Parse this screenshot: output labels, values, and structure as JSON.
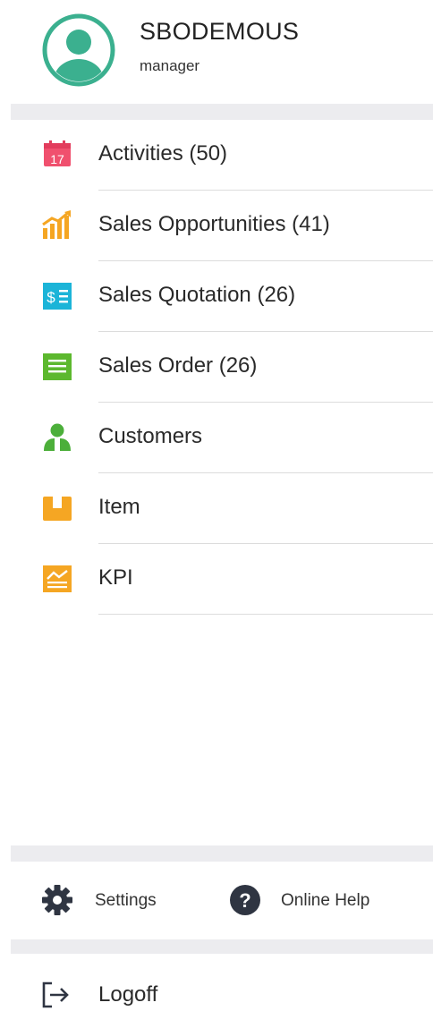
{
  "profile": {
    "name": "SBODEMOUS",
    "role": "manager",
    "avatar_icon": "user-avatar-icon",
    "avatar_color": "#3bb08f"
  },
  "menu": [
    {
      "label": "Activities (50)",
      "icon": "calendar-icon",
      "color": "#f0506e"
    },
    {
      "label": "Sales Opportunities (41)",
      "icon": "bar-chart-icon",
      "color": "#f5a623"
    },
    {
      "label": "Sales Quotation (26)",
      "icon": "quotation-icon",
      "color": "#1bb4d8"
    },
    {
      "label": "Sales Order (26)",
      "icon": "order-list-icon",
      "color": "#5cb82e"
    },
    {
      "label": "Customers",
      "icon": "customers-icon",
      "color": "#4caf3a"
    },
    {
      "label": "Item",
      "icon": "box-icon",
      "color": "#f5a623"
    },
    {
      "label": "KPI",
      "icon": "kpi-chart-icon",
      "color": "#f5a623"
    }
  ],
  "footer": {
    "settings_label": "Settings",
    "settings_icon": "gear-icon",
    "help_label": "Online Help",
    "help_icon": "question-icon",
    "logoff_label": "Logoff",
    "logoff_icon": "logout-icon"
  }
}
